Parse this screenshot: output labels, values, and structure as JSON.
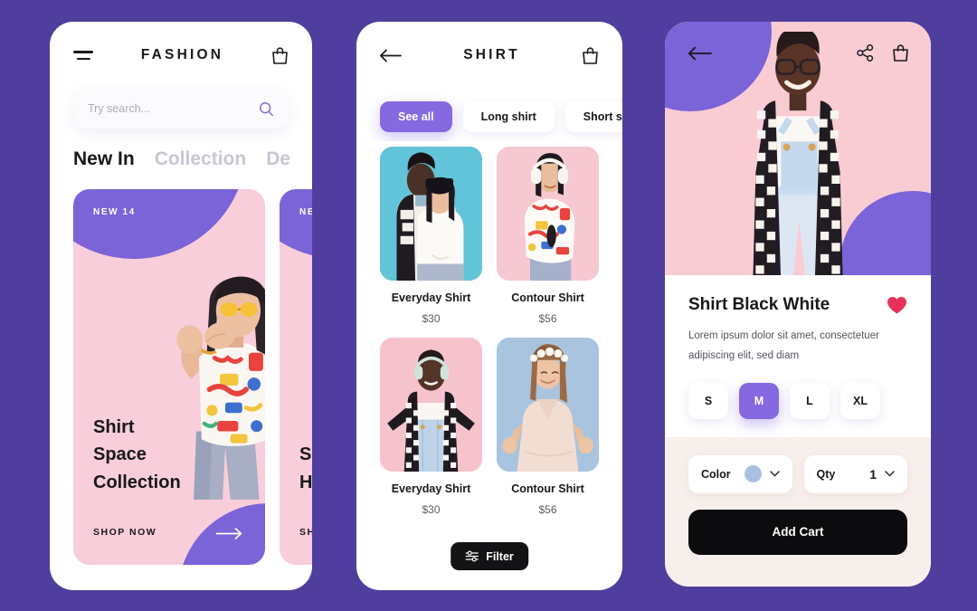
{
  "theme": {
    "background": "#4F3E9E",
    "accent_purple": "#8569E0",
    "pink": "#F8CEDA",
    "cream": "#F7EFEC",
    "black": "#0C0C0E",
    "heart_red": "#E8325A",
    "color_swatch": "#A8C1E3"
  },
  "screen1": {
    "menu_icon": "hamburger-icon",
    "title": "FASHION",
    "bag_icon": "shopping-bag-icon",
    "search": {
      "placeholder": "Try search...",
      "value": "",
      "icon": "search-icon"
    },
    "tabs": [
      {
        "label": "New In",
        "active": true
      },
      {
        "label": "Collection",
        "active": false
      },
      {
        "label": "De",
        "active": false
      }
    ],
    "cards": [
      {
        "badge": "NEW 14",
        "headline_lines": [
          "Shirt",
          "Space",
          "Collection"
        ],
        "cta": "SHOP NOW",
        "arrow_icon": "arrow-right-icon",
        "bg": "#F8CEDA"
      },
      {
        "badge": "NEW",
        "headline_lines": [
          "Sm",
          "Hig"
        ],
        "cta": "SHO",
        "arrow_icon": "arrow-right-icon",
        "bg": "#F8CEDA"
      }
    ]
  },
  "screen2": {
    "back_icon": "arrow-left-icon",
    "title": "SHIRT",
    "bag_icon": "shopping-bag-icon",
    "chips": [
      {
        "label": "See all",
        "active": true
      },
      {
        "label": "Long shirt",
        "active": false
      },
      {
        "label": "Short shir",
        "active": false
      }
    ],
    "products": [
      {
        "name": "Everyday Shirt",
        "price": "$30",
        "bg": "#62C4D8"
      },
      {
        "name": "Contour Shirt",
        "price": "$56",
        "bg": "#F6C9D2"
      },
      {
        "name": "Everyday Shirt",
        "price": "$30",
        "bg": "#F6C3CC"
      },
      {
        "name": "Contour Shirt",
        "price": "$56",
        "bg": "#A9C4DE"
      }
    ],
    "filter": {
      "label": "Filter",
      "icon": "sliders-icon"
    }
  },
  "screen3": {
    "back_icon": "arrow-left-icon",
    "share_icon": "share-icon",
    "bag_icon": "shopping-bag-icon",
    "title": "Shirt Black White",
    "favorite_icon": "heart-icon",
    "description": "Lorem ipsum dolor sit amet, consectetuer adipiscing elit, sed diam",
    "sizes": [
      {
        "label": "S",
        "active": false
      },
      {
        "label": "M",
        "active": true
      },
      {
        "label": "L",
        "active": false
      },
      {
        "label": "XL",
        "active": false
      }
    ],
    "color_selector": {
      "label": "Color",
      "swatch": "#A8C1E3",
      "chevron_icon": "chevron-down-icon"
    },
    "qty_selector": {
      "label": "Qty",
      "value": "1",
      "chevron_icon": "chevron-down-icon"
    },
    "add_cart_label": "Add Cart"
  }
}
